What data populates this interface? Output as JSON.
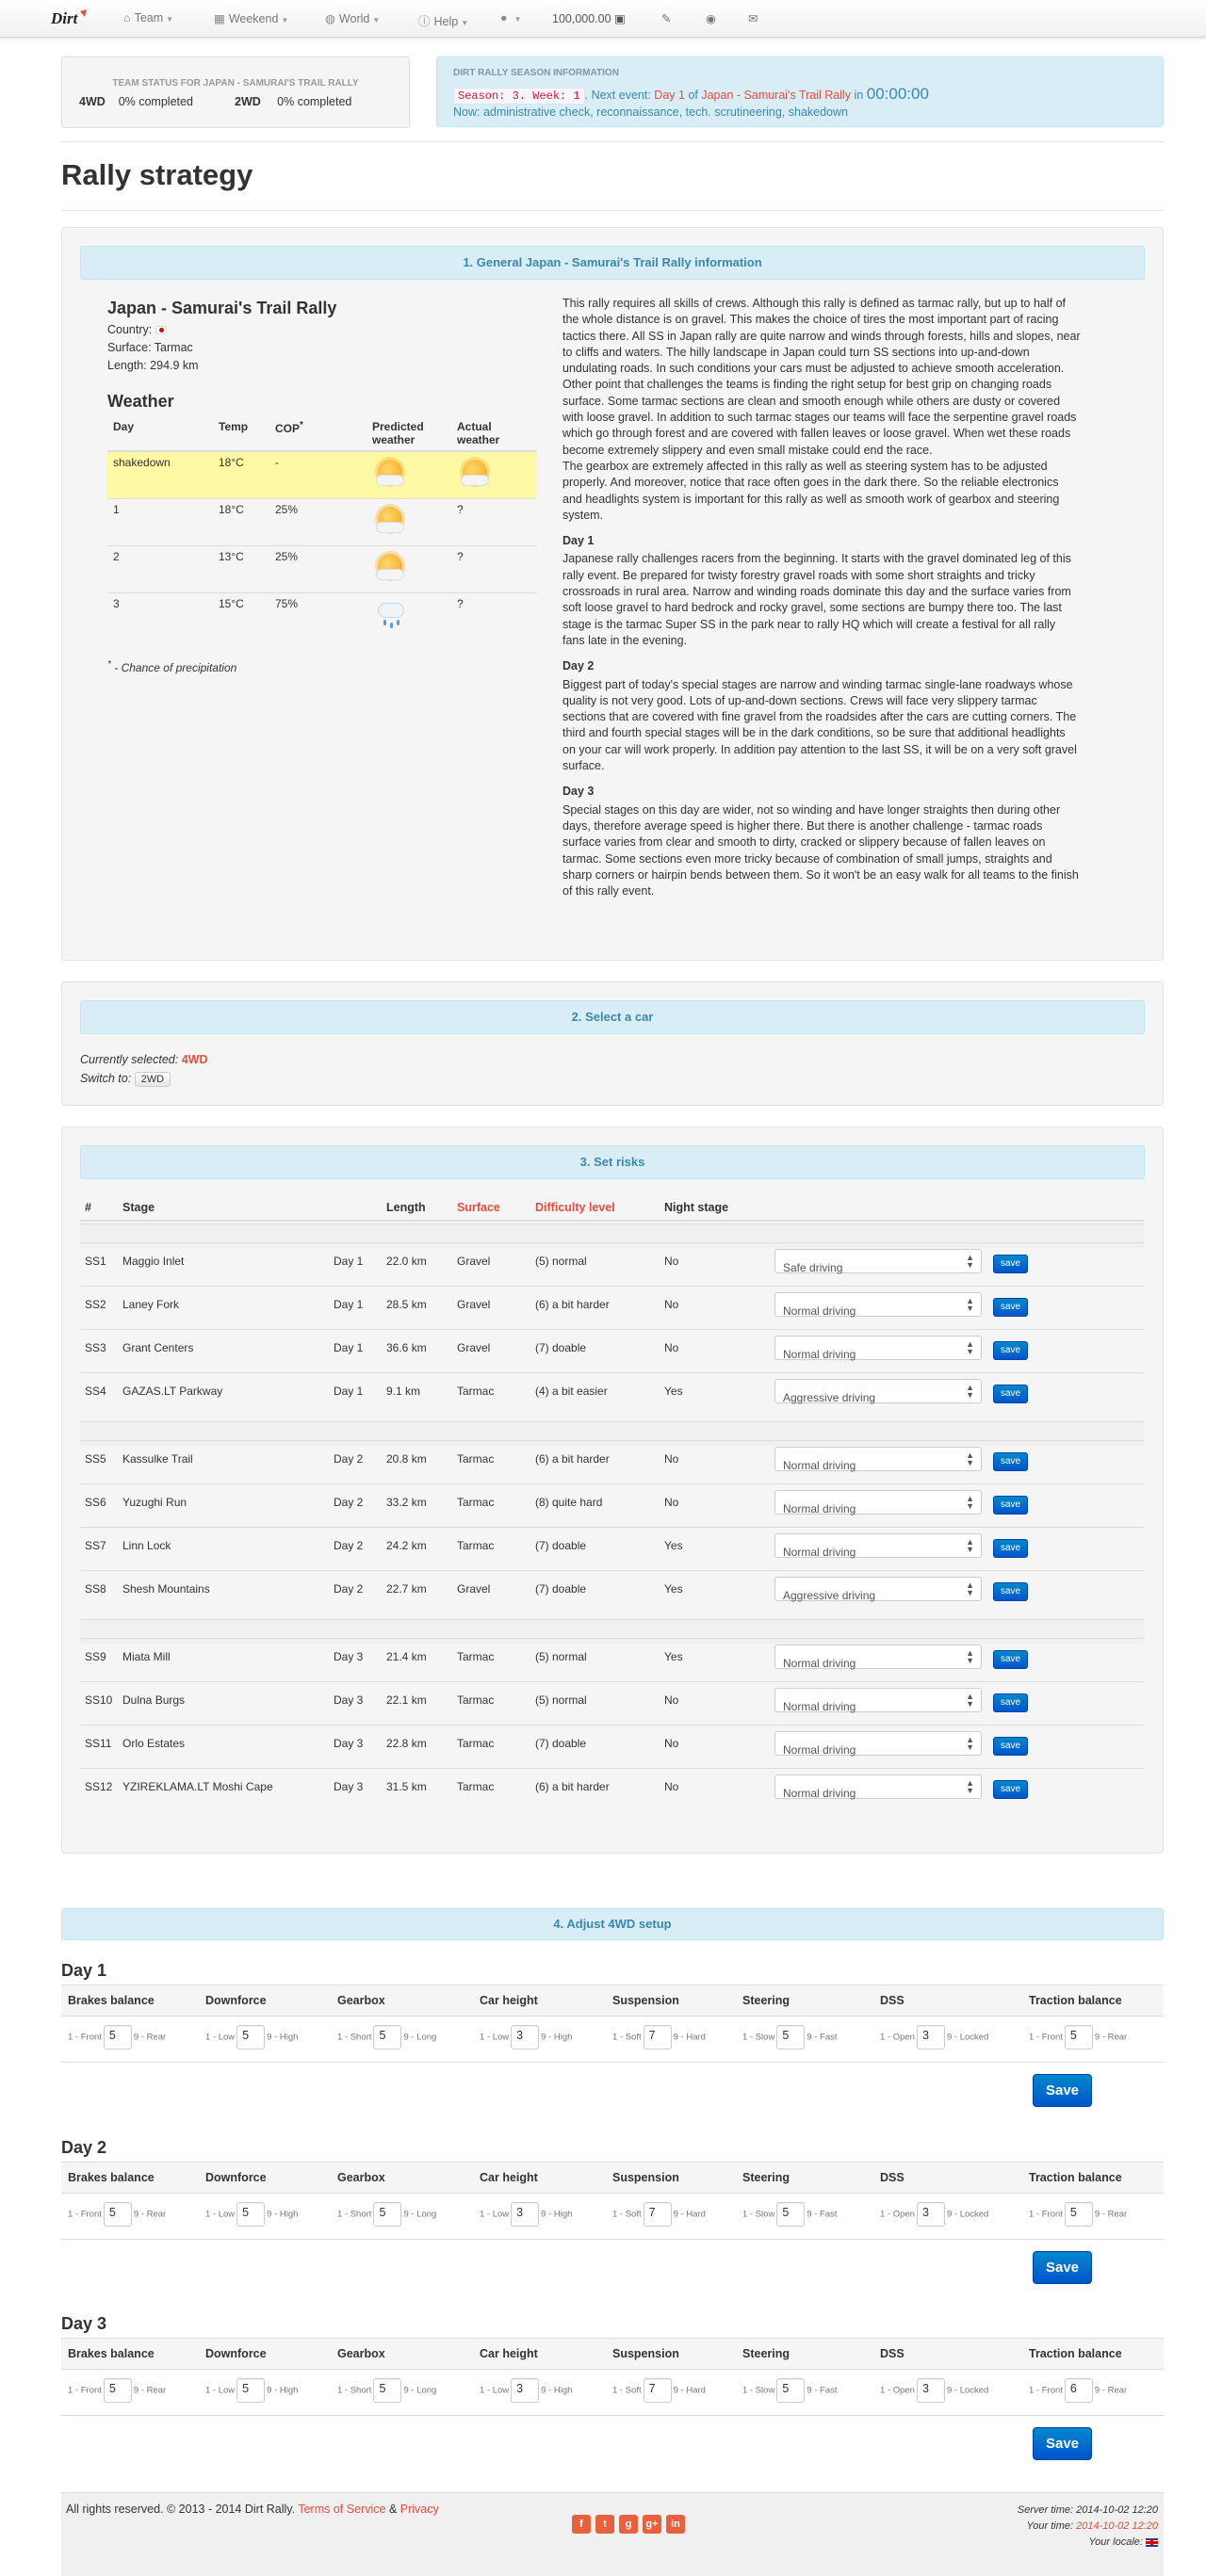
{
  "nav": {
    "team": "Team",
    "weekend": "Weekend",
    "world": "World",
    "help": "Help",
    "money": "100,000.00"
  },
  "team_status": {
    "title": "TEAM STATUS FOR JAPAN - SAMURAI'S TRAIL RALLY",
    "rows": [
      {
        "car": "4WD",
        "value": "0% completed"
      },
      {
        "car": "2WD",
        "value": "0% completed"
      }
    ]
  },
  "season_info": {
    "title": "DIRT RALLY SEASON INFORMATION",
    "season_code": "Season: 3. Week: 1",
    "next_event_label": ". Next event:",
    "day": "Day 1",
    "of": "of",
    "event": "Japan - Samurai's Trail Rally",
    "in": "in",
    "timer": "00:00:00",
    "now_label": "Now:",
    "now_value": "administrative check, reconnaissance, tech. scrutineering, shakedown"
  },
  "page_title": "Rally strategy",
  "general": {
    "heading": "1. General Japan - Samurai's Trail Rally information",
    "rally_name": "Japan - Samurai's Trail Rally",
    "country_label": "Country:",
    "surface": "Surface: Tarmac",
    "length": "Length: 294.9 km",
    "weather_title": "Weather",
    "weather_headers": [
      "Day",
      "Temp",
      "COP",
      "Predicted weather",
      "Actual weather"
    ],
    "weather_rows": [
      {
        "day": "shakedown",
        "temp": "18°C",
        "cop": "-",
        "pred": "sun-cloud",
        "actual": "sun-cloud"
      },
      {
        "day": "1",
        "temp": "18°C",
        "cop": "25%",
        "pred": "sun-cloud",
        "actual": "?"
      },
      {
        "day": "2",
        "temp": "13°C",
        "cop": "25%",
        "pred": "sun-cloud",
        "actual": "?"
      },
      {
        "day": "3",
        "temp": "15°C",
        "cop": "75%",
        "pred": "rain",
        "actual": "?"
      }
    ],
    "cop_note": "- Chance of precipitation",
    "intro_1": "This rally requires all skills of crews. Although this rally is defined as tarmac rally, but up to half of the whole distance is on gravel. This makes the choice of tires the most important part of racing tactics there. All SS in Japan rally are quite narrow and winds through forests, hills and slopes, near to cliffs and waters. The hilly landscape in Japan could turn SS sections into up-and-down undulating roads. In such conditions your cars must be adjusted to achieve smooth acceleration. Other point that challenges the teams is finding the right setup for best grip on changing roads surface. Some tarmac sections are clean and smooth enough while others are dusty or covered with loose gravel. In addition to such tarmac stages our teams will face the serpentine gravel roads which go through forest and are covered with fallen leaves or loose gravel. When wet these roads become extremely slippery and even small mistake could end the race.",
    "intro_2": "The gearbox are extremely affected in this rally as well as steering system has to be adjusted properly. And moreover, notice that race often goes in the dark there. So the reliable electronics and headlights system is important for this rally as well as smooth work of gearbox and steering system.",
    "day1_title": "Day 1",
    "day1_text": "Japanese rally challenges racers from the beginning. It starts with the gravel dominated leg of this rally event. Be prepared for twisty forestry gravel roads with some short straights and tricky crossroads in rural area. Narrow and winding roads dominate this day and the surface varies from soft loose gravel to hard bedrock and rocky gravel, some sections are bumpy there too. The last stage is the tarmac Super SS in the park near to rally HQ which will create a festival for all rally fans late in the evening.",
    "day2_title": "Day 2",
    "day2_text": "Biggest part of today's special stages are narrow and winding tarmac single-lane roadways whose quality is not very good. Lots of up-and-down sections. Crews will face very slippery tarmac sections that are covered with fine gravel from the roadsides after the cars are cutting corners. The third and fourth special stages will be in the dark conditions, so be sure that additional headlights on your car will work properly. In addition pay attention to the last SS, it will be on a very soft gravel surface.",
    "day3_title": "Day 3",
    "day3_text": "Special stages on this day are wider, not so winding and have longer straights then during other days, therefore average speed is higher there. But there is another challenge - tarmac roads surface varies from clear and smooth to dirty, cracked or slippery because of fallen leaves on tarmac. Some sections even more tricky because of combination of small jumps, straights and sharp corners or hairpin bends between them. So it won't be an easy walk for all teams to the finish of this rally event."
  },
  "select_car": {
    "heading": "2. Select a car",
    "current_label": "Currently selected:",
    "current_value": "4WD",
    "switch_label": "Switch to:",
    "switch_button": "2WD"
  },
  "risks": {
    "heading": "3. Set risks",
    "headers": {
      "num": "#",
      "stage": "Stage",
      "length": "Length",
      "surface": "Surface",
      "difficulty": "Difficulty level",
      "night": "Night stage"
    },
    "save_label": "save",
    "stages": [
      {
        "ss": "SS1",
        "name": "Maggio Inlet",
        "day": "Day 1",
        "length": "22.0 km",
        "surface": "Gravel",
        "difficulty": "(5) normal",
        "night": "No",
        "risk": "Safe driving"
      },
      {
        "ss": "SS2",
        "name": "Laney Fork",
        "day": "Day 1",
        "length": "28.5 km",
        "surface": "Gravel",
        "difficulty": "(6) a bit harder",
        "night": "No",
        "risk": "Normal driving"
      },
      {
        "ss": "SS3",
        "name": "Grant Centers",
        "day": "Day 1",
        "length": "36.6 km",
        "surface": "Gravel",
        "difficulty": "(7) doable",
        "night": "No",
        "risk": "Normal driving"
      },
      {
        "ss": "SS4",
        "name": "GAZAS.LT Parkway",
        "day": "Day 1",
        "length": "9.1 km",
        "surface": "Tarmac",
        "difficulty": "(4) a bit easier",
        "night": "Yes",
        "risk": "Aggressive driving"
      },
      {
        "ss": "SS5",
        "name": "Kassulke Trail",
        "day": "Day 2",
        "length": "20.8 km",
        "surface": "Tarmac",
        "difficulty": "(6) a bit harder",
        "night": "No",
        "risk": "Normal driving"
      },
      {
        "ss": "SS6",
        "name": "Yuzughi Run",
        "day": "Day 2",
        "length": "33.2 km",
        "surface": "Tarmac",
        "difficulty": "(8) quite hard",
        "night": "No",
        "risk": "Normal driving"
      },
      {
        "ss": "SS7",
        "name": "Linn Lock",
        "day": "Day 2",
        "length": "24.2 km",
        "surface": "Tarmac",
        "difficulty": "(7) doable",
        "night": "Yes",
        "risk": "Normal driving"
      },
      {
        "ss": "SS8",
        "name": "Shesh Mountains",
        "day": "Day 2",
        "length": "22.7 km",
        "surface": "Gravel",
        "difficulty": "(7) doable",
        "night": "Yes",
        "risk": "Aggressive driving"
      },
      {
        "ss": "SS9",
        "name": "Miata Mill",
        "day": "Day 3",
        "length": "21.4 km",
        "surface": "Tarmac",
        "difficulty": "(5) normal",
        "night": "Yes",
        "risk": "Normal driving"
      },
      {
        "ss": "SS10",
        "name": "Dulna Burgs",
        "day": "Day 3",
        "length": "22.1 km",
        "surface": "Tarmac",
        "difficulty": "(5) normal",
        "night": "No",
        "risk": "Normal driving"
      },
      {
        "ss": "SS11",
        "name": "Orlo Estates",
        "day": "Day 3",
        "length": "22.8 km",
        "surface": "Tarmac",
        "difficulty": "(7) doable",
        "night": "No",
        "risk": "Normal driving"
      },
      {
        "ss": "SS12",
        "name": "YZIREKLAMA.LT Moshi Cape",
        "day": "Day 3",
        "length": "31.5 km",
        "surface": "Tarmac",
        "difficulty": "(6) a bit harder",
        "night": "No",
        "risk": "Normal driving"
      }
    ]
  },
  "setup": {
    "heading": "4. Adjust 4WD setup",
    "columns": [
      {
        "name": "Brakes balance",
        "low": "1 - Front",
        "high": "9 - Rear"
      },
      {
        "name": "Downforce",
        "low": "1 - Low",
        "high": "9 - High"
      },
      {
        "name": "Gearbox",
        "low": "1 - Short",
        "high": "9 - Long"
      },
      {
        "name": "Car height",
        "low": "1 - Low",
        "high": "9 - High"
      },
      {
        "name": "Suspension",
        "low": "1 - Soft",
        "high": "9 - Hard"
      },
      {
        "name": "Steering",
        "low": "1 - Slow",
        "high": "9 - Fast"
      },
      {
        "name": "DSS",
        "low": "1 - Open",
        "high": "9 - Locked"
      },
      {
        "name": "Traction balance",
        "low": "1 - Front",
        "high": "9 - Rear"
      }
    ],
    "save_label": "Save",
    "days": [
      {
        "title": "Day 1",
        "values": [
          "5",
          "5",
          "5",
          "3",
          "7",
          "5",
          "3",
          "5"
        ]
      },
      {
        "title": "Day 2",
        "values": [
          "5",
          "5",
          "5",
          "3",
          "7",
          "5",
          "3",
          "5"
        ]
      },
      {
        "title": "Day 3",
        "values": [
          "5",
          "5",
          "5",
          "3",
          "7",
          "5",
          "3",
          "6"
        ]
      }
    ]
  },
  "footer": {
    "copyright": "All rights reserved. © 2013 - 2014 Dirt Rally.",
    "terms": "Terms of Service",
    "amp": "&",
    "privacy": "Privacy",
    "server_time_label": "Server time:",
    "server_time": "2014-10-02 12:20",
    "your_time_label": "Your time:",
    "your_time": "2014-10-02 12:20",
    "locale_label": "Your locale:",
    "social": [
      "f",
      "t",
      "g",
      "g+",
      "in"
    ]
  }
}
